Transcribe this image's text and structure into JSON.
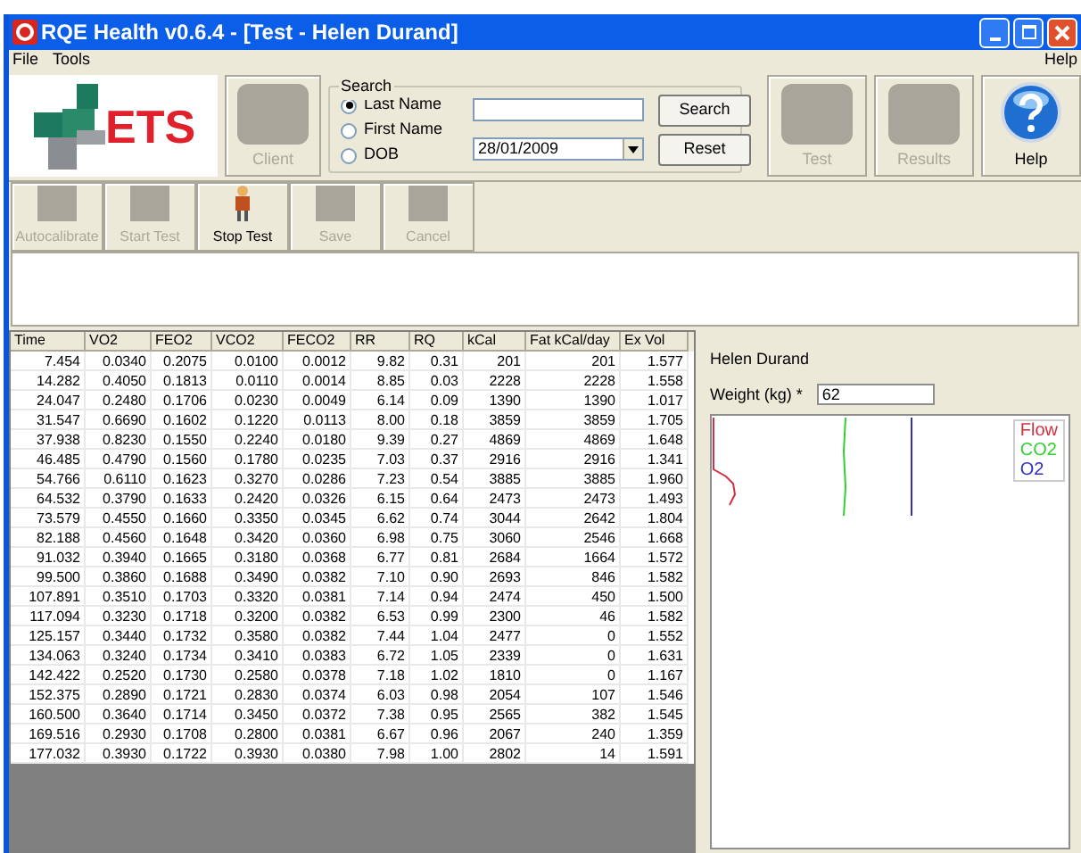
{
  "window": {
    "title": "RQE Health v0.6.4 - [Test - Helen Durand]"
  },
  "menu": {
    "left": [
      "File",
      "Tools"
    ],
    "right": "Help"
  },
  "logo": {
    "text": "ETS"
  },
  "toolbar": [
    {
      "label": "Client",
      "disabled": true
    },
    {
      "label": "Test",
      "disabled": true
    },
    {
      "label": "Results",
      "disabled": true
    },
    {
      "label": "Help",
      "disabled": false
    }
  ],
  "search": {
    "legend": "Search",
    "options": [
      {
        "label": "Last Name",
        "selected": true
      },
      {
        "label": "First Name",
        "selected": false
      },
      {
        "label": "DOB",
        "selected": false
      }
    ],
    "date": "28/01/2009",
    "buttons": [
      "Search",
      "Reset"
    ]
  },
  "test_toolbar": [
    {
      "label": "Autocalibrate",
      "disabled": true
    },
    {
      "label": "Start Test",
      "disabled": true
    },
    {
      "label": "Stop Test",
      "disabled": false
    },
    {
      "label": "Save",
      "disabled": true
    },
    {
      "label": "Cancel",
      "disabled": true
    }
  ],
  "table": {
    "columns": [
      "Time",
      "VO2",
      "FEO2",
      "VCO2",
      "FECO2",
      "RR",
      "RQ",
      "kCal",
      "Fat kCal/day",
      "Ex Vol"
    ],
    "rows": [
      [
        "7.454",
        "0.0340",
        "0.2075",
        "0.0100",
        "0.0012",
        "9.82",
        "0.31",
        "201",
        "201",
        "1.577"
      ],
      [
        "14.282",
        "0.4050",
        "0.1813",
        "0.0110",
        "0.0014",
        "8.85",
        "0.03",
        "2228",
        "2228",
        "1.558"
      ],
      [
        "24.047",
        "0.2480",
        "0.1706",
        "0.0230",
        "0.0049",
        "6.14",
        "0.09",
        "1390",
        "1390",
        "1.017"
      ],
      [
        "31.547",
        "0.6690",
        "0.1602",
        "0.1220",
        "0.0113",
        "8.00",
        "0.18",
        "3859",
        "3859",
        "1.705"
      ],
      [
        "37.938",
        "0.8230",
        "0.1550",
        "0.2240",
        "0.0180",
        "9.39",
        "0.27",
        "4869",
        "4869",
        "1.648"
      ],
      [
        "46.485",
        "0.4790",
        "0.1560",
        "0.1780",
        "0.0235",
        "7.03",
        "0.37",
        "2916",
        "2916",
        "1.341"
      ],
      [
        "54.766",
        "0.6110",
        "0.1623",
        "0.3270",
        "0.0286",
        "7.23",
        "0.54",
        "3885",
        "3885",
        "1.960"
      ],
      [
        "64.532",
        "0.3790",
        "0.1633",
        "0.2420",
        "0.0326",
        "6.15",
        "0.64",
        "2473",
        "2473",
        "1.493"
      ],
      [
        "73.579",
        "0.4550",
        "0.1660",
        "0.3350",
        "0.0345",
        "6.62",
        "0.74",
        "3044",
        "2642",
        "1.804"
      ],
      [
        "82.188",
        "0.4560",
        "0.1648",
        "0.3420",
        "0.0360",
        "6.98",
        "0.75",
        "3060",
        "2546",
        "1.668"
      ],
      [
        "91.032",
        "0.3940",
        "0.1665",
        "0.3180",
        "0.0368",
        "6.77",
        "0.81",
        "2684",
        "1664",
        "1.572"
      ],
      [
        "99.500",
        "0.3860",
        "0.1688",
        "0.3490",
        "0.0382",
        "7.10",
        "0.90",
        "2693",
        "846",
        "1.582"
      ],
      [
        "107.891",
        "0.3510",
        "0.1703",
        "0.3320",
        "0.0381",
        "7.14",
        "0.94",
        "2474",
        "450",
        "1.500"
      ],
      [
        "117.094",
        "0.3230",
        "0.1718",
        "0.3200",
        "0.0382",
        "6.53",
        "0.99",
        "2300",
        "46",
        "1.582"
      ],
      [
        "125.157",
        "0.3440",
        "0.1732",
        "0.3580",
        "0.0382",
        "7.44",
        "1.04",
        "2477",
        "0",
        "1.552"
      ],
      [
        "134.063",
        "0.3240",
        "0.1734",
        "0.3410",
        "0.0383",
        "6.72",
        "1.05",
        "2339",
        "0",
        "1.631"
      ],
      [
        "142.422",
        "0.2520",
        "0.1730",
        "0.2580",
        "0.0378",
        "7.18",
        "1.02",
        "1810",
        "0",
        "1.167"
      ],
      [
        "152.375",
        "0.2890",
        "0.1721",
        "0.2830",
        "0.0374",
        "6.03",
        "0.98",
        "2054",
        "107",
        "1.546"
      ],
      [
        "160.500",
        "0.3640",
        "0.1714",
        "0.3450",
        "0.0372",
        "7.38",
        "0.95",
        "2565",
        "382",
        "1.545"
      ],
      [
        "169.516",
        "0.2930",
        "0.1708",
        "0.2800",
        "0.0381",
        "6.67",
        "0.96",
        "2067",
        "240",
        "1.359"
      ],
      [
        "177.032",
        "0.3930",
        "0.1722",
        "0.3930",
        "0.0380",
        "7.98",
        "1.00",
        "2802",
        "14",
        "1.591"
      ]
    ]
  },
  "client_panel": {
    "name": "Helen Durand",
    "weight_label": "Weight (kg) *",
    "weight": "62"
  },
  "trace": {
    "legend": [
      {
        "label": "Flow",
        "color": "#d03040"
      },
      {
        "label": "CO2",
        "color": "#30d030"
      },
      {
        "label": "O2",
        "color": "#3030c0"
      }
    ]
  }
}
